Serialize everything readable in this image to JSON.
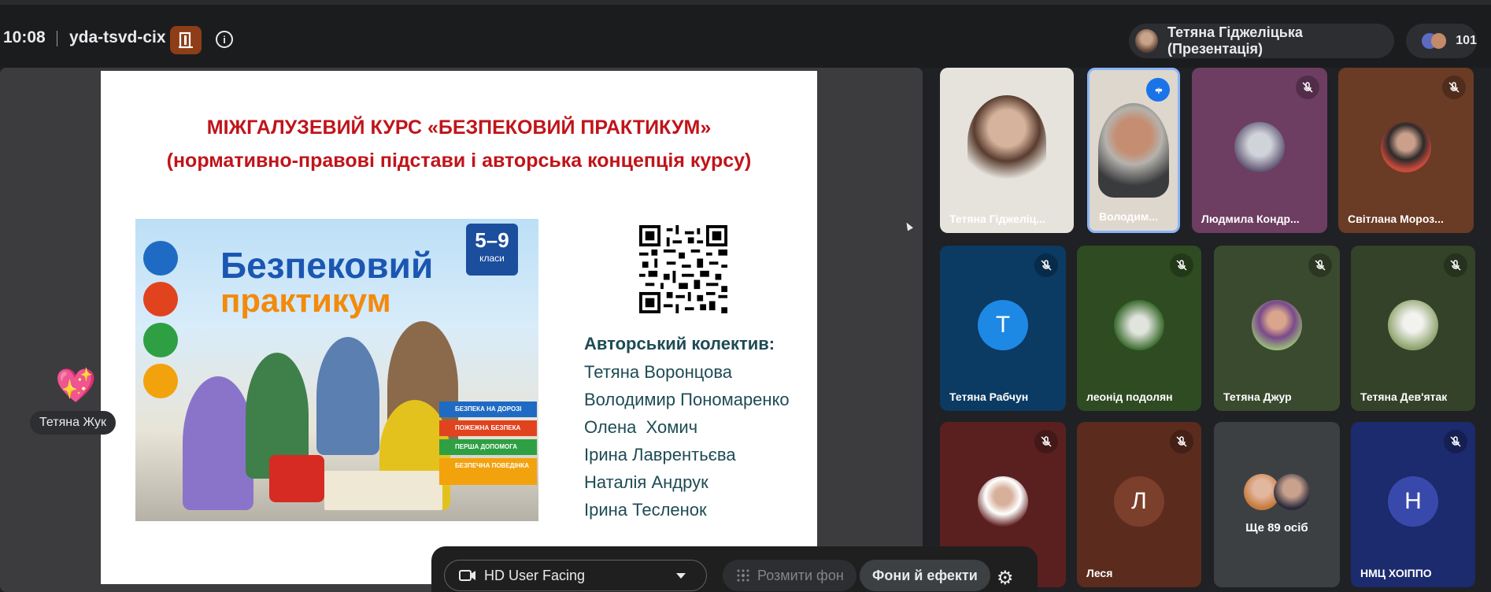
{
  "header": {
    "time": "10:08",
    "meeting_code": "yda-tsvd-cix",
    "presenter_label": "Тетяна Гіджеліцька (Презентація)",
    "participant_count": "101"
  },
  "slide": {
    "title_line1": "МІЖГАЛУЗЕВИЙ КУРС «БЕЗПЕКОВИЙ ПРАКТИКУМ»",
    "title_line2": "(нормативно-правові підстави і авторська концепція курсу)",
    "poster": {
      "title1": "Безпековий",
      "title2": "практикум",
      "grade": "5–9",
      "grade_sub": "класи",
      "ribbons": [
        "БЕЗПЕКА НА ДОРОЗІ",
        "ПОЖЕЖНА БЕЗПЕКА",
        "ПЕРША ДОПОМОГА",
        "БЕЗПЕЧНА ПОВЕДІНКА"
      ]
    },
    "authors_heading": "Авторський колектив:",
    "authors": [
      "Тетяна Воронцова",
      "Володимир Пономаренко",
      "Олена  Хомич",
      "Ірина Лаврентьєва",
      "Наталія Андрук",
      "Ірина Тесленок"
    ]
  },
  "reaction": {
    "emoji": "💖",
    "name": "Тетяна Жук"
  },
  "participants": [
    {
      "name": "Тетяна Гіджеліц...",
      "muted": false
    },
    {
      "name": "Володим...",
      "muted": false,
      "speaking": true
    },
    {
      "name": "Людмила Кондр...",
      "muted": true
    },
    {
      "name": "Світлана Мороз...",
      "muted": true
    },
    {
      "name": "Тетяна Рабчун",
      "muted": true,
      "letter": "Т"
    },
    {
      "name": "леонід подолян",
      "muted": true
    },
    {
      "name": "Тетяна Джур",
      "muted": true
    },
    {
      "name": "Тетяна Дев'ятак",
      "muted": true
    },
    {
      "name": "",
      "muted": true
    },
    {
      "name": "Леся",
      "muted": true,
      "letter": "Л"
    },
    {
      "name": "Ще 89 осіб",
      "muted": false
    },
    {
      "name": "НМЦ ХОІППО",
      "muted": true,
      "letter": "Н"
    }
  ],
  "controls": {
    "camera_label": "HD User Facing",
    "blur_label": "Розмити фон",
    "effects_label": "Фони й ефекти"
  },
  "colors": {
    "slide_title": "#c0141a",
    "authors_text": "#1e4b54",
    "accent_blue": "#1a73e8"
  }
}
